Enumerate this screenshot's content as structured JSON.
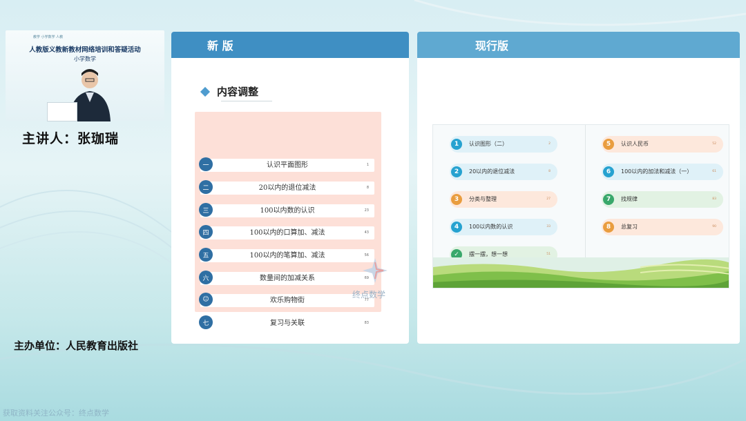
{
  "left": {
    "video_small": "教学 小学数学 人教",
    "video_title": "人教版义教新教材网络培训和答疑活动",
    "video_subtitle": "小学数学",
    "speaker": "主讲人：张珈瑞",
    "organizer": "主办单位：人民教育出版社",
    "footer_watermark": "获取资料关注公众号：终点数学"
  },
  "panel_new": {
    "header": "新 版",
    "section_title": "内容调整",
    "toc": [
      {
        "num": "一",
        "label": "认识平面图形",
        "page": "1"
      },
      {
        "num": "二",
        "label": "20以内的退位减法",
        "page": "8"
      },
      {
        "num": "三",
        "label": "100以内数的认识",
        "page": "23"
      },
      {
        "num": "四",
        "label": "100以内的口算加、减法",
        "page": "43"
      },
      {
        "num": "五",
        "label": "100以内的笔算加、减法",
        "page": "56"
      },
      {
        "num": "六",
        "label": "数量间的加减关系",
        "page": "69"
      },
      {
        "num": "☺",
        "label": "欢乐购物街",
        "page": "77"
      },
      {
        "num": "七",
        "label": "复习与关联",
        "page": "83"
      }
    ],
    "brand": "终点数学"
  },
  "panel_current": {
    "header": "现行版",
    "left_items": [
      {
        "num": "1",
        "label": "认识图形（二）",
        "page": "2",
        "color": "blue"
      },
      {
        "num": "2",
        "label": "20以内的退位减法",
        "page": "8",
        "color": "blue"
      },
      {
        "num": "3",
        "label": "分类与整理",
        "page": "27",
        "color": "peach"
      },
      {
        "num": "4",
        "label": "100以内数的认识",
        "page": "33",
        "color": "blue"
      },
      {
        "num": "✓",
        "label": "摆一摆，想一想",
        "page": "51",
        "color": "green"
      }
    ],
    "right_items": [
      {
        "num": "5",
        "label": "认识人民币",
        "page": "52",
        "color": "peach"
      },
      {
        "num": "6",
        "label": "100以内的加法和减法（一）",
        "page": "61",
        "color": "blue"
      },
      {
        "num": "7",
        "label": "找规律",
        "page": "83",
        "color": "green"
      },
      {
        "num": "8",
        "label": "总复习",
        "page": "90",
        "color": "peach"
      }
    ]
  }
}
